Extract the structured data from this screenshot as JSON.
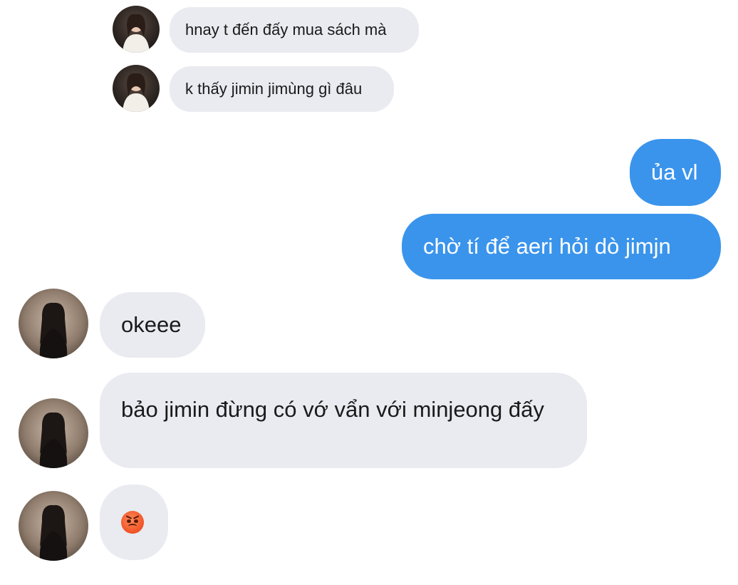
{
  "conversation": {
    "messages": [
      {
        "sender": "other-1",
        "text": "hnay t đến đấy mua sách mà"
      },
      {
        "sender": "other-1",
        "text": "k thấy jimin jimùng gì đâu"
      },
      {
        "sender": "me",
        "text": "ủa vl"
      },
      {
        "sender": "me",
        "text": "chờ tí để aeri hỏi dò jimjn"
      },
      {
        "sender": "other-2",
        "text": "okeee"
      },
      {
        "sender": "other-2",
        "text": "bảo jimin đừng có vớ vẩn với minjeong đấy"
      },
      {
        "sender": "other-2",
        "emoji": "angry-face"
      }
    ]
  },
  "colors": {
    "sent_bubble": "#3a94ec",
    "received_bubble": "#e9ebf0"
  },
  "icons": {
    "avatar": "profile-photo",
    "reaction_emoji": "angry-face"
  }
}
